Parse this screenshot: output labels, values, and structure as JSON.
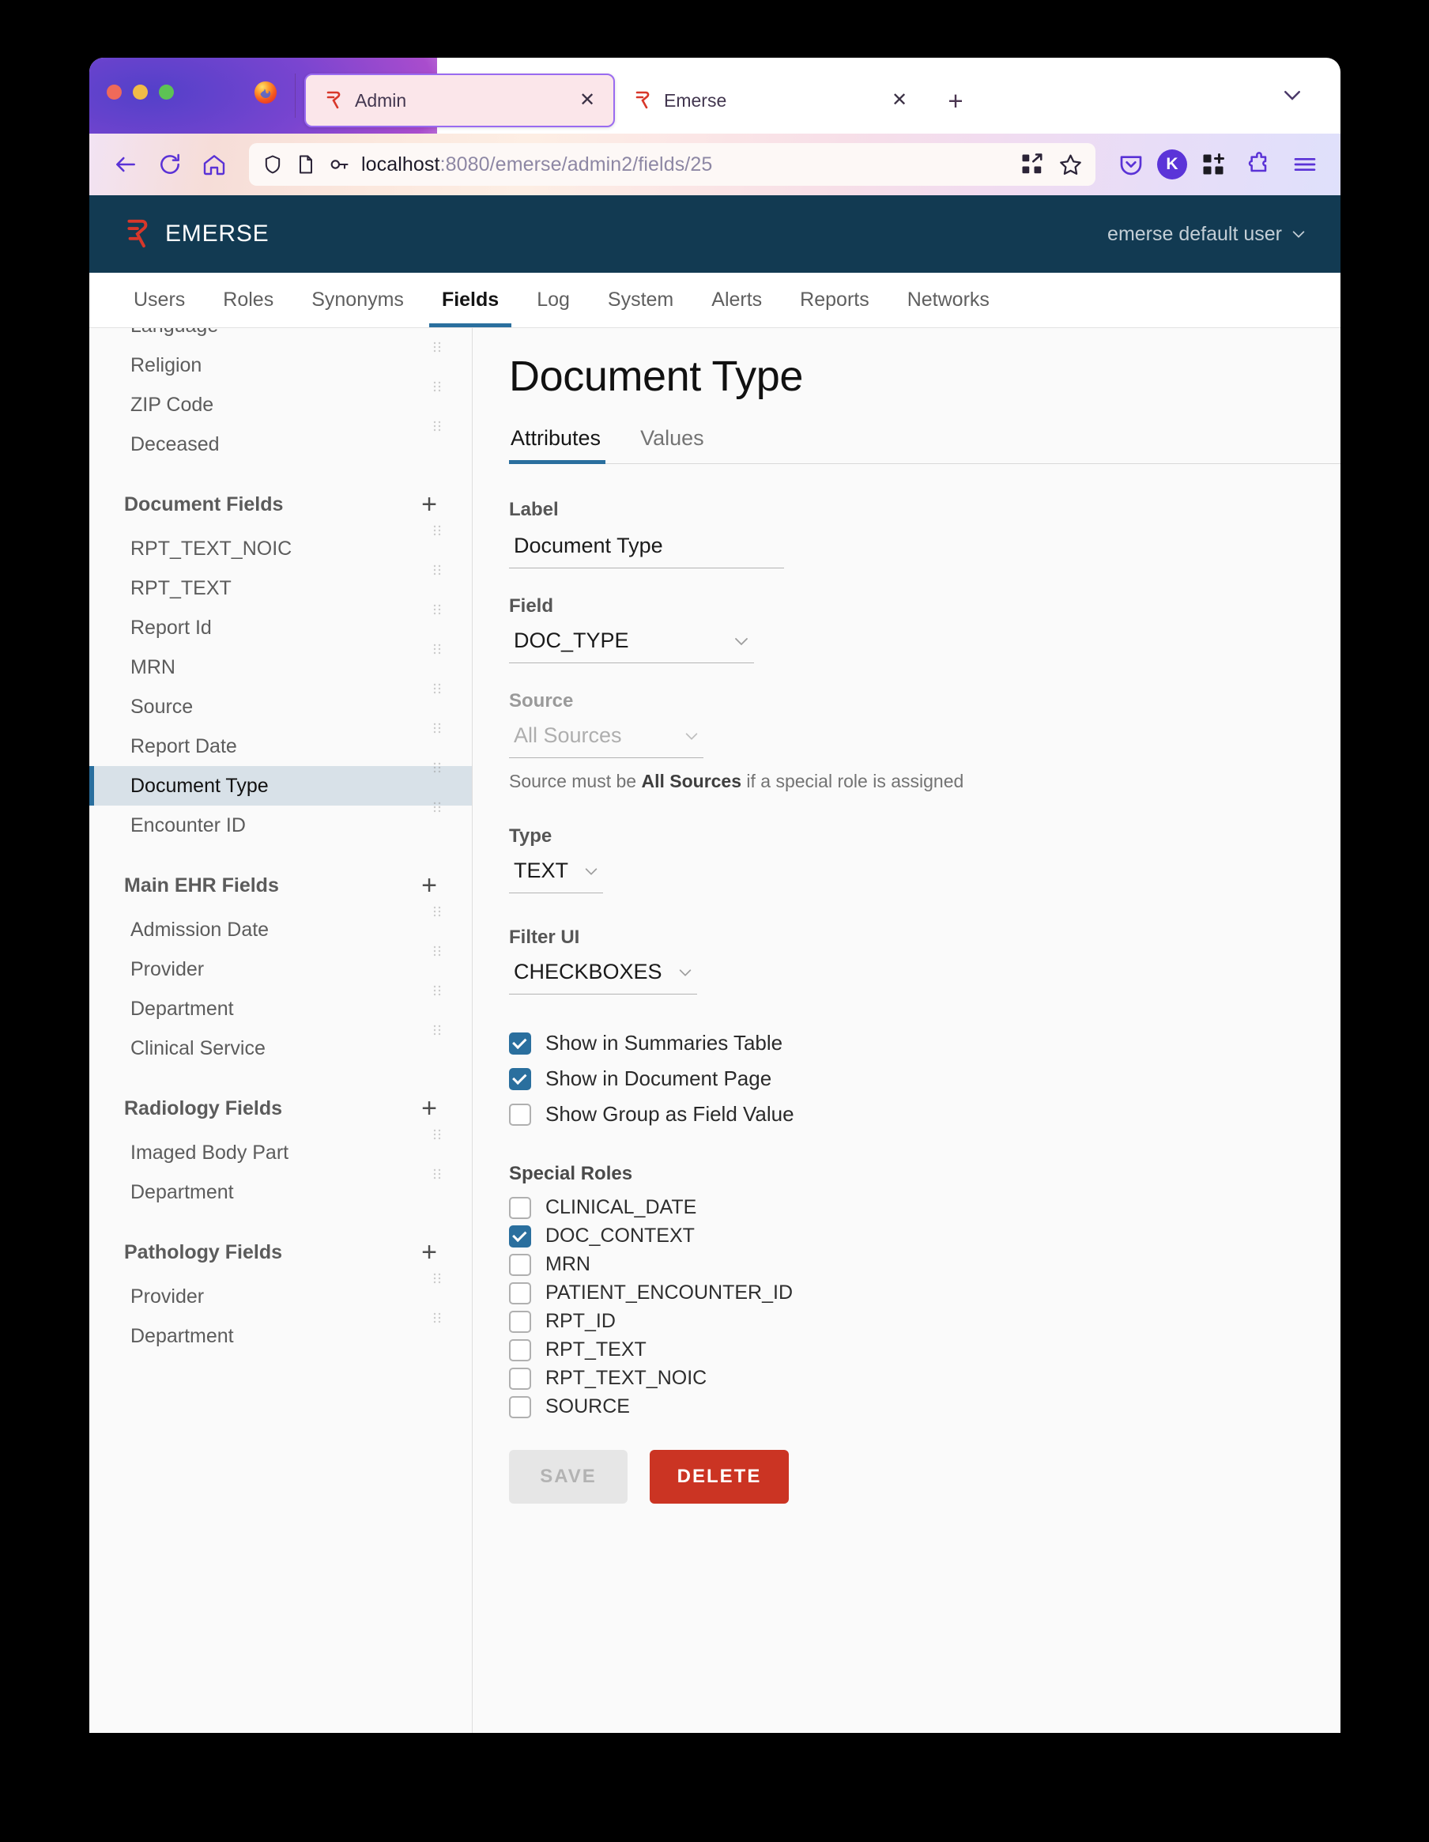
{
  "browser": {
    "tabs": [
      {
        "title": "Admin",
        "favicon": "emerse-icon",
        "active": true
      },
      {
        "title": "Emerse",
        "favicon": "emerse-icon",
        "active": false
      }
    ],
    "new_tab_label": "+",
    "url": {
      "host": "localhost",
      "path": ":8080/emerse/admin2/fields/25"
    },
    "avatar_initial": "K",
    "icons": {
      "back": "back-arrow-icon",
      "forward": "forward-arrow-icon",
      "reload": "reload-icon",
      "home": "home-icon",
      "shield": "shield-icon",
      "page": "page-icon",
      "key": "key-icon",
      "qr": "qr-code-icon",
      "bookmark": "star-icon",
      "pocket": "pocket-icon",
      "extensions": "puzzle-icon",
      "grid_add": "grid-plus-icon",
      "menu": "hamburger-menu-icon",
      "tab_list": "chevron-down-icon"
    }
  },
  "app": {
    "brand": "EMERSE",
    "user": "emerse default user",
    "nav_tabs": [
      {
        "label": "Users",
        "active": false
      },
      {
        "label": "Roles",
        "active": false
      },
      {
        "label": "Synonyms",
        "active": false
      },
      {
        "label": "Fields",
        "active": true
      },
      {
        "label": "Log",
        "active": false
      },
      {
        "label": "System",
        "active": false
      },
      {
        "label": "Alerts",
        "active": false
      },
      {
        "label": "Reports",
        "active": false
      },
      {
        "label": "Networks",
        "active": false
      }
    ]
  },
  "sidebar": {
    "add_label": "+",
    "groups": [
      {
        "header": null,
        "items": [
          {
            "label": "Language",
            "selected": false,
            "clipped": true
          },
          {
            "label": "Religion",
            "selected": false
          },
          {
            "label": "ZIP Code",
            "selected": false
          },
          {
            "label": "Deceased",
            "selected": false
          }
        ]
      },
      {
        "header": "Document Fields",
        "items": [
          {
            "label": "RPT_TEXT_NOIC",
            "selected": false
          },
          {
            "label": "RPT_TEXT",
            "selected": false
          },
          {
            "label": "Report Id",
            "selected": false
          },
          {
            "label": "MRN",
            "selected": false
          },
          {
            "label": "Source",
            "selected": false
          },
          {
            "label": "Report Date",
            "selected": false
          },
          {
            "label": "Document Type",
            "selected": true
          },
          {
            "label": "Encounter ID",
            "selected": false
          }
        ]
      },
      {
        "header": "Main EHR Fields",
        "items": [
          {
            "label": "Admission Date",
            "selected": false
          },
          {
            "label": "Provider",
            "selected": false
          },
          {
            "label": "Department",
            "selected": false
          },
          {
            "label": "Clinical Service",
            "selected": false
          }
        ]
      },
      {
        "header": "Radiology Fields",
        "items": [
          {
            "label": "Imaged Body Part",
            "selected": false
          },
          {
            "label": "Department",
            "selected": false
          }
        ]
      },
      {
        "header": "Pathology Fields",
        "items": [
          {
            "label": "Provider",
            "selected": false
          },
          {
            "label": "Department",
            "selected": false,
            "clipped": true
          }
        ]
      }
    ]
  },
  "main": {
    "title": "Document Type",
    "tabs": [
      {
        "label": "Attributes",
        "active": true
      },
      {
        "label": "Values",
        "active": false
      }
    ],
    "form": {
      "label_caption": "Label",
      "label_value": "Document Type",
      "field_caption": "Field",
      "field_value": "DOC_TYPE",
      "source_caption": "Source",
      "source_value": "All Sources",
      "source_hint_prefix": "Source must be ",
      "source_hint_bold": "All Sources",
      "source_hint_suffix": " if a special role is assigned",
      "type_caption": "Type",
      "type_value": "TEXT",
      "filter_ui_caption": "Filter UI",
      "filter_ui_value": "CHECKBOXES",
      "toggles": [
        {
          "label": "Show in Summaries Table",
          "checked": true
        },
        {
          "label": "Show in Document Page",
          "checked": true
        },
        {
          "label": "Show Group as Field Value",
          "checked": false
        }
      ],
      "special_roles_caption": "Special Roles",
      "special_roles": [
        {
          "label": "CLINICAL_DATE",
          "checked": false
        },
        {
          "label": "DOC_CONTEXT",
          "checked": true
        },
        {
          "label": "MRN",
          "checked": false
        },
        {
          "label": "PATIENT_ENCOUNTER_ID",
          "checked": false
        },
        {
          "label": "RPT_ID",
          "checked": false
        },
        {
          "label": "RPT_TEXT",
          "checked": false
        },
        {
          "label": "RPT_TEXT_NOIC",
          "checked": false
        },
        {
          "label": "SOURCE",
          "checked": false
        }
      ],
      "save_label": "SAVE",
      "delete_label": "DELETE"
    }
  },
  "colors": {
    "accent_blue": "#2a6f9e",
    "header_navy": "#123a52",
    "brand_red": "#d8372a",
    "delete_red": "#cb3423",
    "selected_row": "#d8e1e8"
  }
}
